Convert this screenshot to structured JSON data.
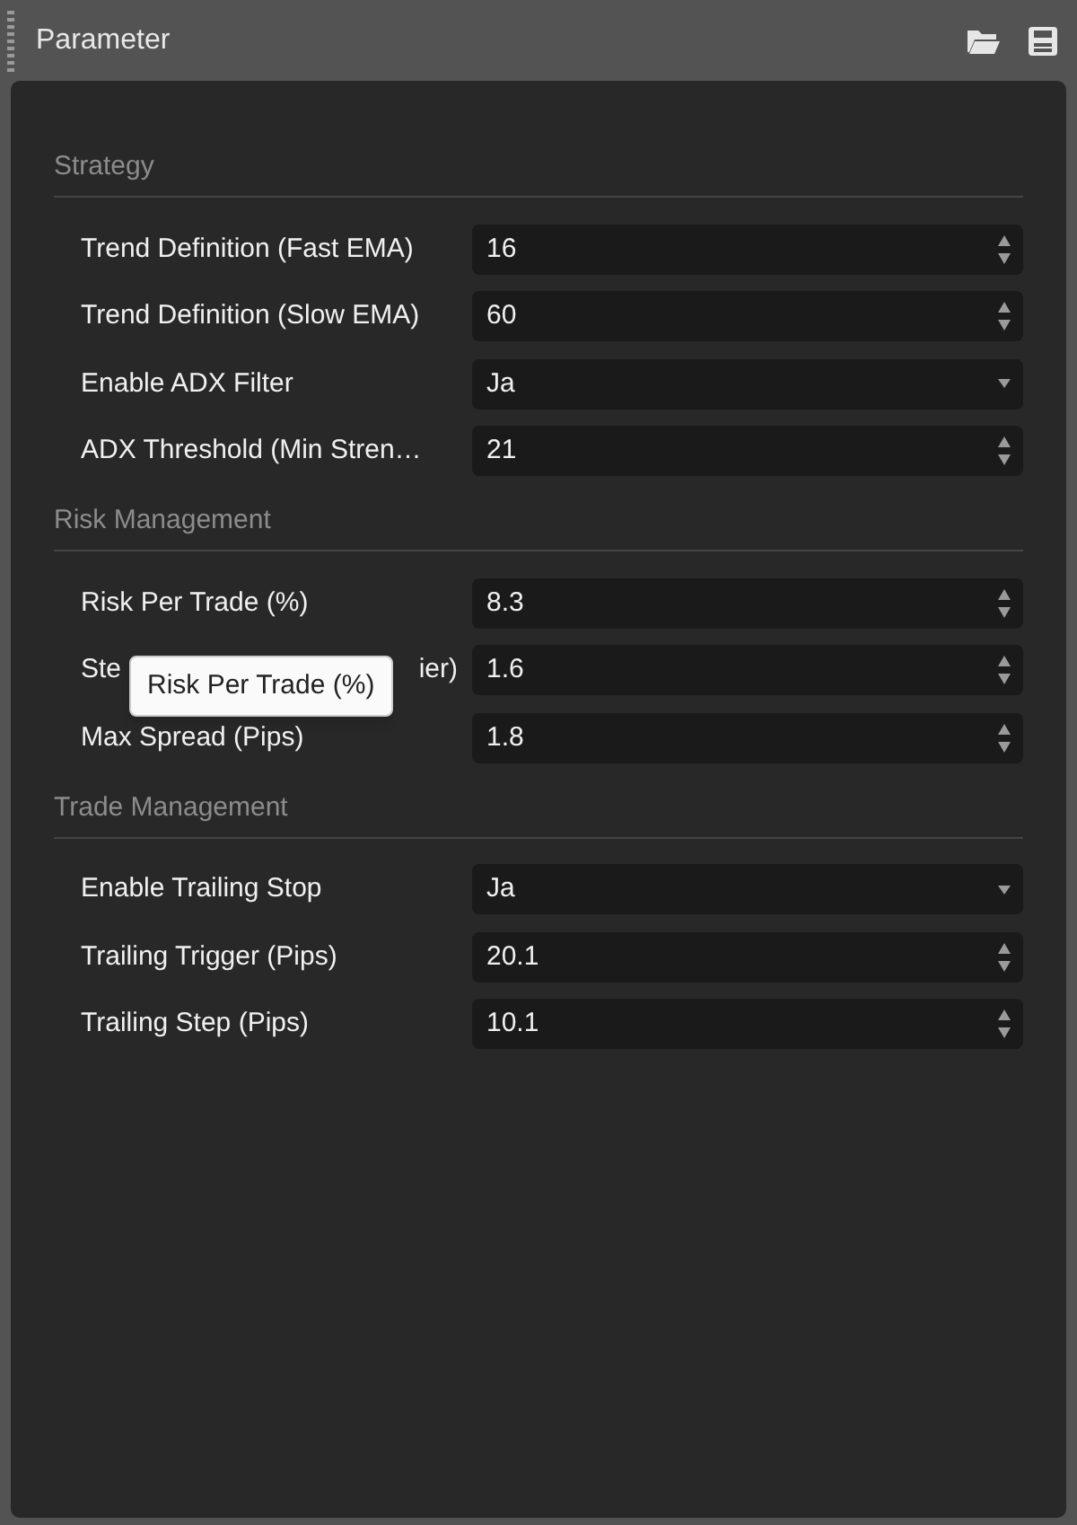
{
  "panel": {
    "title": "Parameter"
  },
  "sections": [
    {
      "title": "Strategy",
      "rows": [
        {
          "kind": "number",
          "label": "Trend Definition (Fast EMA)",
          "value": "16"
        },
        {
          "kind": "number",
          "label": "Trend Definition (Slow EMA)",
          "value": "60"
        },
        {
          "kind": "choice",
          "label": "Enable ADX Filter",
          "value": "Ja"
        },
        {
          "kind": "number",
          "label": "ADX Threshold (Min Stren…",
          "value": "21"
        }
      ]
    },
    {
      "title": "Risk Management",
      "rows": [
        {
          "kind": "number",
          "label": "Risk Per Trade (%)",
          "value": "8.3"
        },
        {
          "kind": "number",
          "label_parts": [
            "Ste",
            "ier)"
          ],
          "value": "1.6"
        },
        {
          "kind": "number",
          "label": "Max Spread (Pips)",
          "value": "1.8"
        }
      ]
    },
    {
      "title": "Trade Management",
      "rows": [
        {
          "kind": "choice",
          "label": "Enable Trailing Stop",
          "value": "Ja"
        },
        {
          "kind": "number",
          "label": "Trailing Trigger (Pips)",
          "value": "20.1"
        },
        {
          "kind": "number",
          "label": "Trailing Step (Pips)",
          "value": "10.1"
        }
      ]
    }
  ],
  "tooltip": {
    "text": "Risk Per Trade (%)"
  }
}
